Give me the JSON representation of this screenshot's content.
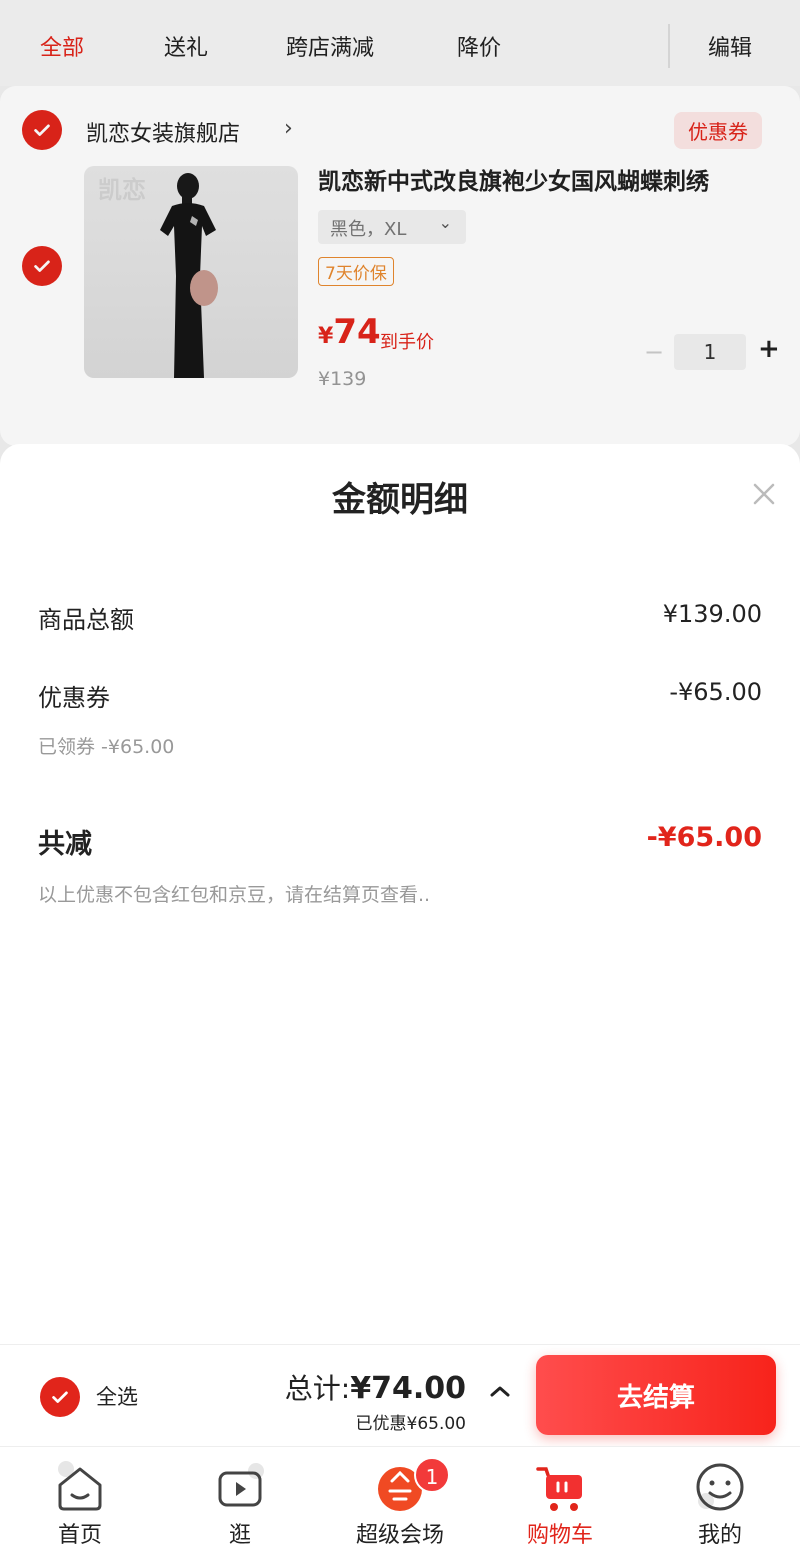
{
  "tabs": [
    {
      "label": "全部",
      "active": true
    },
    {
      "label": "送礼",
      "active": false
    },
    {
      "label": "跨店满减",
      "active": false
    },
    {
      "label": "降价",
      "active": false
    }
  ],
  "edit_label": "编辑",
  "shop": {
    "name": "凯恋女装旗舰店",
    "chevron": "›",
    "coupon_tag": "优惠券",
    "product": {
      "image_watermark": "凯恋",
      "title": "凯恋新中式改良旗袍少女国风蝴蝶刺绣",
      "spec": "黑色，XL",
      "badge": "7天价保",
      "price_currency": "¥",
      "price_value": "74",
      "price_tag": "到手价",
      "original_price": "¥139",
      "quantity": "1",
      "minus": "−",
      "plus": "+"
    }
  },
  "sheet": {
    "title": "金额明细",
    "rows": [
      {
        "label": "商品总额",
        "value": "¥139.00"
      },
      {
        "label": "优惠券",
        "value": "-¥65.00",
        "sub": "已领券 -¥65.00"
      }
    ],
    "total_label": "共减",
    "total_value": "-¥65.00",
    "note": "以上优惠不包含红包和京豆，请在结算页查看.."
  },
  "checkout": {
    "select_all": "全选",
    "total_prefix": "总计:",
    "total_amount": "¥74.00",
    "discount": "已优惠¥65.00",
    "button": "去结算"
  },
  "tabbar": {
    "items": [
      {
        "label": "首页",
        "icon": "home-icon"
      },
      {
        "label": "逛",
        "icon": "video-icon"
      },
      {
        "label": "超级会场",
        "icon": "promo-icon",
        "badge": "1"
      },
      {
        "label": "购物车",
        "icon": "cart-icon",
        "active": true
      },
      {
        "label": "我的",
        "icon": "profile-icon"
      }
    ]
  },
  "colors": {
    "accent": "#e1251b",
    "orange": "#e98a2f"
  }
}
